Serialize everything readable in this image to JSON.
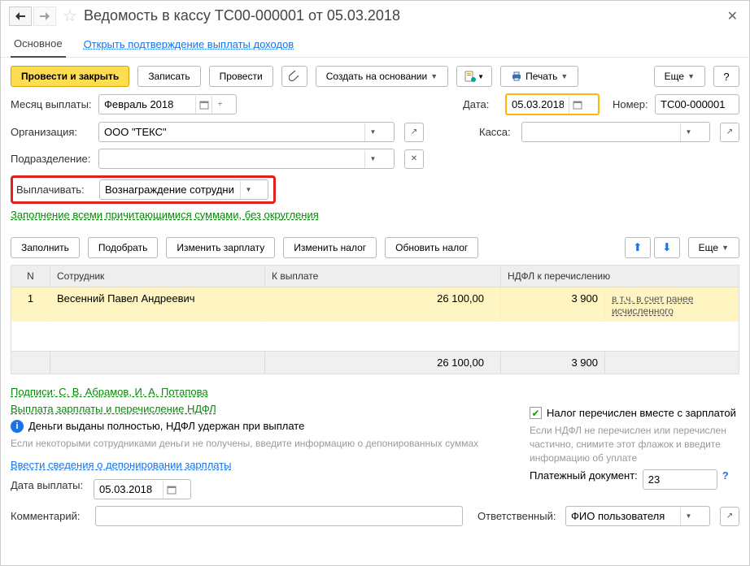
{
  "title": "Ведомость в кассу ТС00-000001 от 05.03.2018",
  "tabs": {
    "main": "Основное",
    "confirm": "Открыть подтверждение выплаты доходов"
  },
  "toolbar": {
    "post_close": "Провести и закрыть",
    "save": "Записать",
    "post": "Провести",
    "create_based": "Создать на основании",
    "print": "Печать",
    "more": "Еще"
  },
  "fields": {
    "month_label": "Месяц выплаты:",
    "month_value": "Февраль 2018",
    "date_label": "Дата:",
    "date_value": "05.03.2018",
    "number_label": "Номер:",
    "number_value": "ТС00-000001",
    "org_label": "Организация:",
    "org_value": "ООО \"ТЕКС\"",
    "cash_label": "Касса:",
    "cash_value": "",
    "dep_label": "Подразделение:",
    "dep_value": "",
    "pay_label": "Выплачивать:",
    "pay_value": "Вознаграждение сотрудни"
  },
  "fill_all_link": "Заполнение всеми причитающимися суммами, без округления",
  "table_toolbar": {
    "fill": "Заполнить",
    "select": "Подобрать",
    "edit_salary": "Изменить зарплату",
    "edit_tax": "Изменить налог",
    "update_tax": "Обновить налог",
    "more": "Еще"
  },
  "table": {
    "headers": {
      "n": "N",
      "emp": "Сотрудник",
      "pay": "К выплате",
      "ndfl": "НДФЛ к перечислению"
    },
    "rows": [
      {
        "n": "1",
        "emp": "Весенний Павел Андреевич",
        "pay": "26 100,00",
        "ndfl": "3 900",
        "extra": "в т.ч. в счет ранее исчисленного"
      }
    ],
    "totals": {
      "pay": "26 100,00",
      "ndfl": "3 900"
    }
  },
  "signatures_link": "Подписи: С. В. Абрамов, И. А. Потапова",
  "salary_ndfl_link": "Выплата зарплаты и перечисление НДФЛ",
  "info_text": "Деньги выданы полностью, НДФЛ удержан при выплате",
  "hint_left": "Если некоторыми сотрудниками деньги не получены, введите информацию о депонированных суммах",
  "depo_link": "Ввести сведения о депонировании зарплаты",
  "pay_date_label": "Дата выплаты:",
  "pay_date_value": "05.03.2018",
  "right": {
    "tax_check_label": "Налог перечислен вместе с зарплатой",
    "tax_hint": "Если НДФЛ не перечислен или перечислен частично, снимите этот флажок и введите информацию об уплате",
    "paydoc_label": "Платежный документ:",
    "paydoc_value": "23"
  },
  "comment_label": "Комментарий:",
  "comment_value": "",
  "responsible_label": "Ответственный:",
  "responsible_value": "ФИО пользователя"
}
